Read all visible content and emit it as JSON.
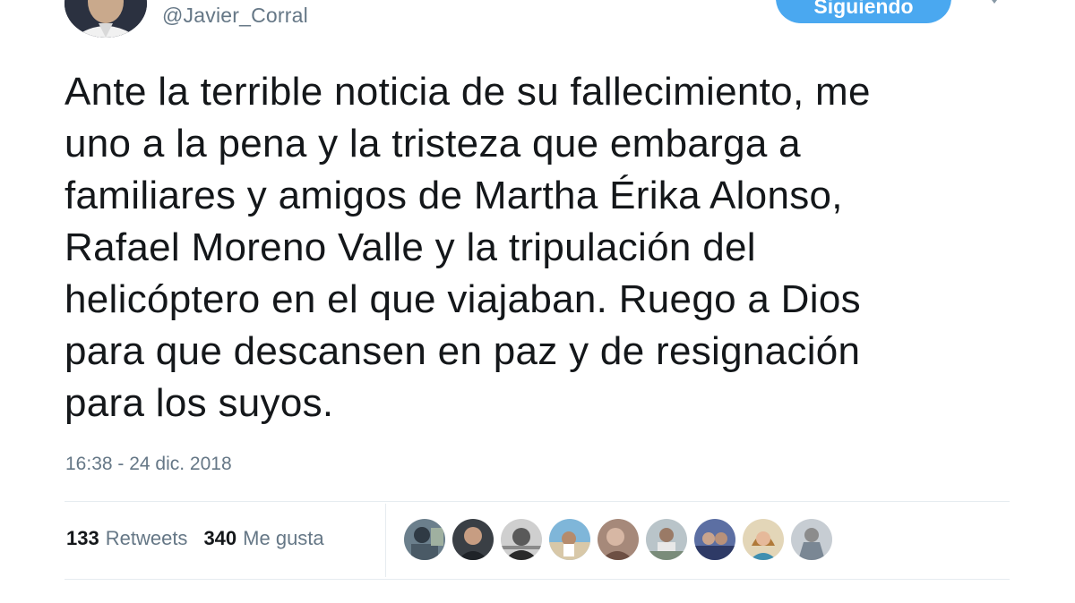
{
  "tweet": {
    "handle": "@Javier_Corral",
    "follow_label": "Siguiendo",
    "text": "Ante la terrible noticia de su fallecimiento, me\nuno a la pena y la tristeza que embarga a\nfamiliares y amigos de Martha Érika Alonso,\nRafael Moreno Valle y la tripulación del\nhelicóptero en el que viajaban. Ruego a Dios\npara que descansen en paz y de resignación\npara los suyos.",
    "timestamp": "16:38 - 24 dic. 2018",
    "retweets": {
      "count": "133",
      "label": "Retweets"
    },
    "likes": {
      "count": "340",
      "label": "Me gusta"
    }
  },
  "colors": {
    "accent": "#4aa8f0",
    "secondary_text": "#657786",
    "divider": "#e6ecf0"
  }
}
